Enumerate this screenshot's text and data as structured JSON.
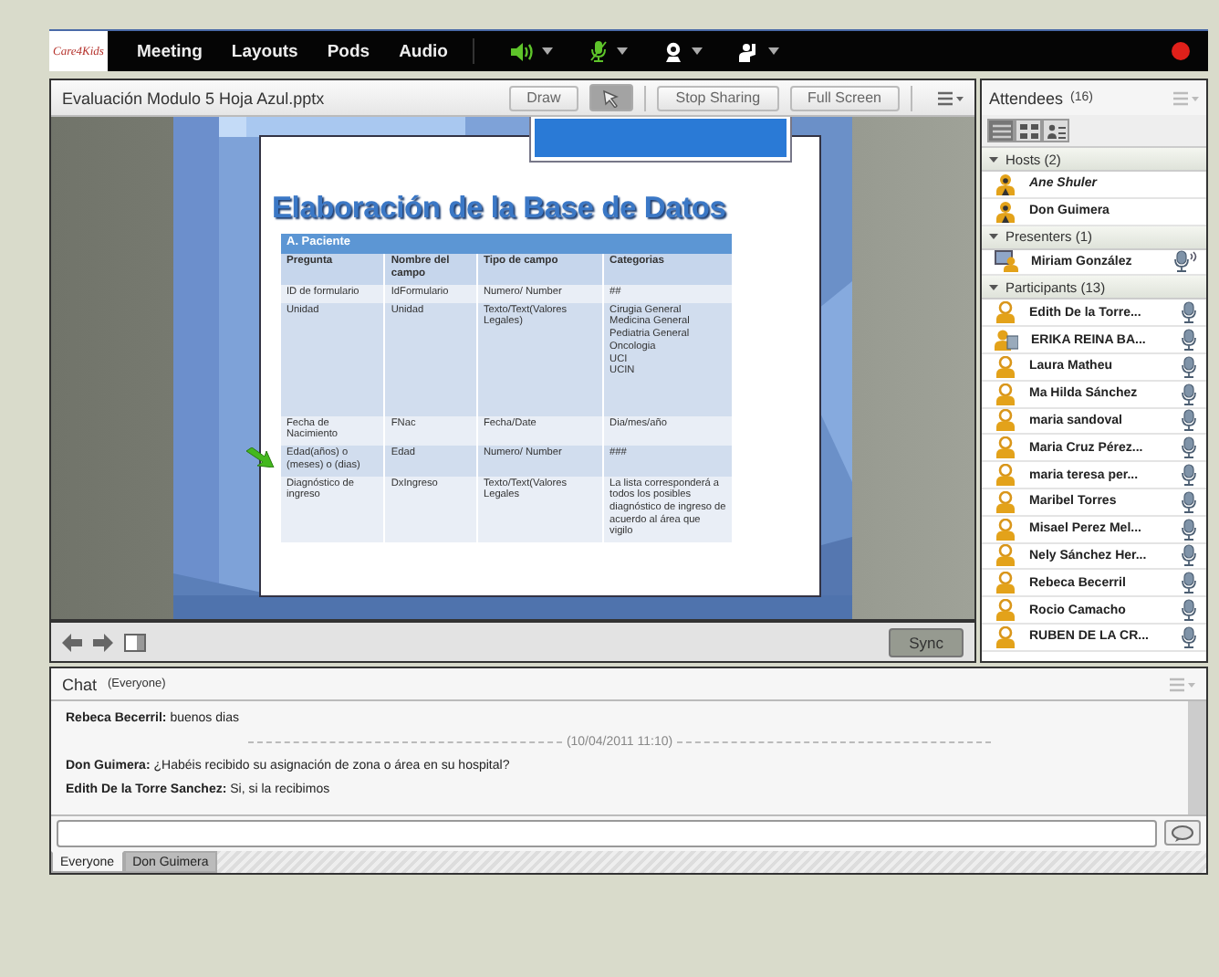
{
  "menu_bar": {
    "logo": "Care4Kids",
    "items": [
      "Meeting",
      "Layouts",
      "Pods",
      "Audio"
    ]
  },
  "share_pod": {
    "title": "Evaluación Modulo 5 Hoja Azul.pptx",
    "buttons": [
      {
        "kind": "text",
        "label": "Draw",
        "selected": false
      },
      {
        "kind": "pointer",
        "selected": true
      },
      {
        "kind": "text",
        "label": "Stop Sharing",
        "selected": false
      },
      {
        "kind": "text",
        "label": "Full Screen",
        "selected": false
      }
    ],
    "slide": {
      "title": "Elaboración de la Base de Datos",
      "section": "A.   Paciente",
      "columns": [
        "Pregunta",
        "Nombre del campo",
        "Tipo de campo",
        "Categorias"
      ],
      "rows": [
        {
          "cells": [
            "ID de formulario",
            "IdFormulario",
            "Numero/ Number",
            "##"
          ],
          "pointer": false
        },
        {
          "cells": [
            "Unidad",
            "Unidad",
            "Texto/Text(Valores Legales)",
            "Cirugia General\nMedicina General\nPediatria General\nOncologia\nUCI\nUCIN"
          ],
          "pointer": false
        },
        {
          "cells": [
            "Fecha de Nacimiento",
            "FNac",
            "Fecha/Date",
            "Dia/mes/año"
          ],
          "pointer": false
        },
        {
          "cells": [
            "Edad(años) o (meses) o (dias)",
            "Edad",
            "Numero/ Number",
            "###"
          ],
          "pointer": true
        },
        {
          "cells": [
            "Diagnóstico de ingreso",
            "DxIngreso",
            "Texto/Text(Valores Legales",
            "La lista corresponderá a todos los posibles diagnóstico de ingreso de acuerdo al área que vigilo"
          ],
          "pointer": false
        }
      ]
    },
    "sync_button": "Sync"
  },
  "attendees": {
    "title": "Attendees",
    "count": "(16)",
    "views": [
      {
        "kind": "list",
        "selected": true
      },
      {
        "kind": "grid",
        "selected": false
      },
      {
        "kind": "role",
        "selected": false
      }
    ],
    "groups": [
      {
        "label": "Hosts (2)",
        "expanded": true,
        "people": [
          {
            "name": "Ane Shuler",
            "kind": "host",
            "current_user": true
          },
          {
            "name": "Don Guimera",
            "kind": "host",
            "current_user": false
          }
        ]
      },
      {
        "label": "Presenters (1)",
        "expanded": true,
        "people": [
          {
            "name": "Miriam González",
            "kind": "presenter",
            "current_user": false
          }
        ]
      },
      {
        "label": "Participants (13)",
        "expanded": true,
        "people": [
          {
            "name": "Edith De la Torre...",
            "kind": "participant",
            "current_user": false
          },
          {
            "name": "ERIKA REINA BA...",
            "kind": "guest",
            "current_user": false
          },
          {
            "name": "Laura Matheu",
            "kind": "participant",
            "current_user": false
          },
          {
            "name": "Ma Hilda Sánchez",
            "kind": "participant",
            "current_user": false
          },
          {
            "name": "maria  sandoval",
            "kind": "participant",
            "current_user": false
          },
          {
            "name": "Maria Cruz Pérez...",
            "kind": "participant",
            "current_user": false
          },
          {
            "name": "maria teresa per...",
            "kind": "participant",
            "current_user": false
          },
          {
            "name": "Maribel Torres",
            "kind": "participant",
            "current_user": false
          },
          {
            "name": "Misael Perez Mel...",
            "kind": "participant",
            "current_user": false
          },
          {
            "name": "Nely Sánchez Her...",
            "kind": "participant",
            "current_user": false
          },
          {
            "name": "Rebeca Becerril",
            "kind": "participant",
            "current_user": false
          },
          {
            "name": "Rocio Camacho",
            "kind": "participant",
            "current_user": false
          },
          {
            "name": "RUBEN DE LA CR...",
            "kind": "participant",
            "current_user": false
          }
        ]
      }
    ]
  },
  "chat": {
    "title": "Chat",
    "scope": "(Everyone)",
    "messages": [
      {
        "kind": "message",
        "sender": "Rebeca Becerril:",
        "text": "buenos dias"
      },
      {
        "kind": "timestamp",
        "text": "(10/04/2011 11:10)"
      },
      {
        "kind": "message",
        "sender": "Don Guimera:",
        "text": "¿Habéis recibido su asignación de zona o área en su hospital?"
      },
      {
        "kind": "message",
        "sender": "Edith De la Torre Sanchez:",
        "text": "Si, si la recibimos"
      }
    ],
    "tabs": [
      {
        "label": "Everyone",
        "selected": true
      },
      {
        "label": "Don Guimera",
        "selected": false
      }
    ]
  }
}
